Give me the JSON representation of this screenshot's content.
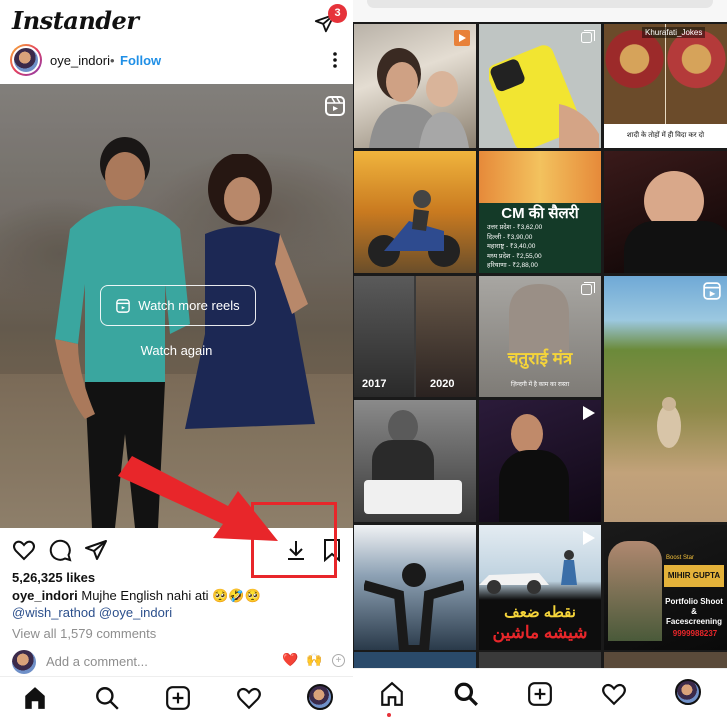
{
  "app": {
    "name": "Instander"
  },
  "topbar": {
    "dm_badge_count": "3"
  },
  "post": {
    "username": "oye_indori",
    "separator": "•",
    "follow_label": "Follow",
    "watch_more_label": "Watch more reels",
    "watch_again_label": "Watch again",
    "likes": "5,26,325 likes",
    "caption_user": "oye_indori",
    "caption_text": "Mujhe English nahi ati 🥺🤣🥺",
    "mentions": "@wish_rathod @oye_indori",
    "view_all_comments": "View all 1,579 comments",
    "comment_placeholder": "Add a comment...",
    "quick_emojis": [
      "❤️",
      "🙌"
    ],
    "quick_plus": "+"
  },
  "explore_grid": {
    "tiles": [
      {
        "overlay_text": ""
      },
      {
        "overlay_text": ""
      },
      {
        "overlay_text": "Khurafati_Jokes",
        "caption": "शादी के तोहों में ही विदा कर दो"
      },
      {
        "overlay_text": ""
      },
      {
        "overlay_text": "CM की सैलरी",
        "rows": [
          "उत्तर प्रदेश - ₹3,62,00",
          "दिल्ली - ₹3,90,00",
          "महाराष्ट्र - ₹3,40,00",
          "मध्य प्रदेश - ₹2,55,00",
          "हरियाणा - ₹2,88,00"
        ]
      },
      {
        "overlay_text": ""
      },
      {
        "overlay_text": "2017",
        "overlay_text_2": "2020"
      },
      {
        "overlay_text": "चतुराई मंत्र",
        "caption": "ज़िन्दगी में है काम का रास्ता"
      },
      {
        "overlay_text": ""
      },
      {
        "overlay_text": ""
      },
      {
        "overlay_text": ""
      },
      {
        "overlay_text": ""
      },
      {
        "overlay_text": ""
      },
      {
        "overlay_text": "نقطه ضعف",
        "overlay_text_2": "شیشه ماشین"
      },
      {
        "overlay_text": "Boost Star",
        "overlay_text_2": "MIHIR GUPTA",
        "overlay_text_3": "Portfolio Shoot & Facescreening",
        "overlay_text_4": "9999988237"
      }
    ]
  },
  "colors": {
    "accent_blue": "#1f8fe6",
    "highlight_red": "#e8262a",
    "badge_red": "#e6323a"
  },
  "icons": {
    "left_nav": [
      "home-icon",
      "search-icon",
      "create-icon",
      "activity-heart-icon",
      "profile-avatar"
    ],
    "right_nav": [
      "home-icon",
      "search-icon",
      "create-icon",
      "activity-heart-icon",
      "profile-avatar"
    ],
    "actions": [
      "like-heart-icon",
      "comment-icon",
      "share-icon",
      "download-icon",
      "save-bookmark-icon"
    ]
  }
}
